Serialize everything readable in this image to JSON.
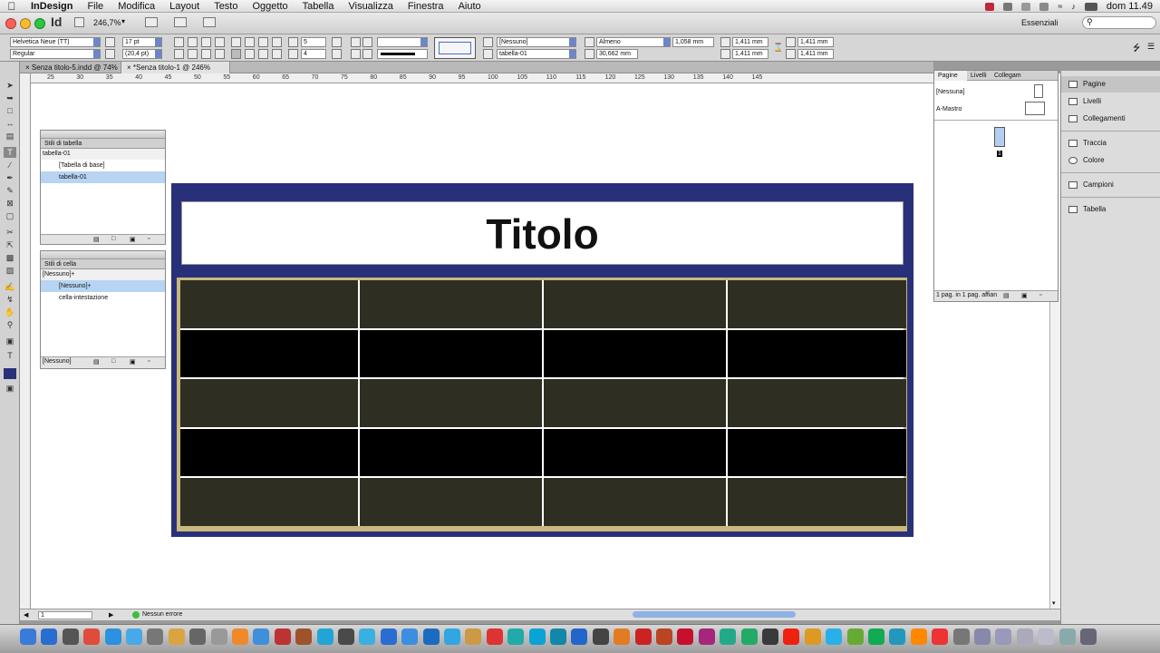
{
  "menubar": {
    "app": "InDesign",
    "items": [
      "File",
      "Modifica",
      "Layout",
      "Testo",
      "Oggetto",
      "Tabella",
      "Visualizza",
      "Finestra",
      "Aiuto"
    ],
    "clock": "dom 11.49"
  },
  "appbar": {
    "logo": "Id",
    "zoom": "246,7%",
    "workspace": "Essenziali"
  },
  "control": {
    "font_family": "Helvetica Neue (TT)",
    "font_style": "Regular",
    "font_size": "17 pt",
    "leading": "(20,4 pt)",
    "rows": "5",
    "cols": "4",
    "cell_style": "[Nessuno]",
    "table_style": "tabella-01",
    "row_height_mode": "Almeno",
    "row_height": "1,058 mm",
    "col_width": "30,662 mm",
    "inset_top": "1,411 mm",
    "inset_bottom": "1,411 mm",
    "inset_left": "1,411 mm",
    "inset_right": "1,411 mm"
  },
  "tabs": [
    {
      "label": "Senza titolo-5.indd @ 74%"
    },
    {
      "label": "*Senza titolo-1 @ 246%"
    }
  ],
  "ruler_ticks": [
    "25",
    "30",
    "35",
    "40",
    "45",
    "50",
    "55",
    "60",
    "65",
    "70",
    "75",
    "80",
    "85",
    "90",
    "95",
    "100",
    "105",
    "110",
    "115",
    "120",
    "125",
    "130",
    "135",
    "140",
    "145"
  ],
  "table_styles_panel": {
    "title": "Stili di tabella",
    "current": "tabella-01",
    "items": [
      "[Tabella di base]",
      "tabella-01"
    ]
  },
  "cell_styles_panel": {
    "title": "Stili di cella",
    "current": "[Nessuno]+",
    "items": [
      "[Nessuno]+",
      "cella-intestazione"
    ],
    "footer": "[Nessuno]"
  },
  "pages_panel": {
    "tabs": [
      "Pagine",
      "Livelli",
      "Collegam"
    ],
    "none_label": "[Nessuna]",
    "master_label": "A-Mastro",
    "page_number": "1",
    "footer": "1 pag. in 1 pag. affian"
  },
  "dock": {
    "items": [
      "Pagine",
      "Livelli",
      "Collegamenti",
      "Traccia",
      "Colore",
      "Campioni",
      "Tabella"
    ]
  },
  "document": {
    "title": "Titolo",
    "table_rows": 5,
    "table_cols": 4
  },
  "status": {
    "page": "1",
    "errors": "Nessun errore"
  },
  "colors": {
    "page_bg": "#29307a",
    "table_border": "#c9b87c",
    "row_odd": "#2e2f22",
    "row_even": "#000000"
  }
}
